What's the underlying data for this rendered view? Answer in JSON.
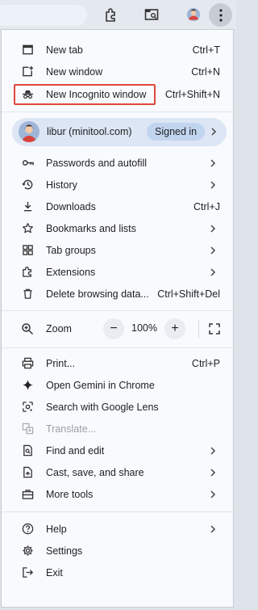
{
  "menu": {
    "group1": [
      {
        "label": "New tab",
        "shortcut": "Ctrl+T",
        "icon": "new-tab-icon"
      },
      {
        "label": "New window",
        "shortcut": "Ctrl+N",
        "icon": "new-window-icon"
      },
      {
        "label": "New Incognito window",
        "shortcut": "Ctrl+Shift+N",
        "icon": "incognito-icon"
      }
    ],
    "profile": {
      "name": "libur (minitool.com)",
      "status": "Signed in"
    },
    "group2": [
      {
        "label": "Passwords and autofill",
        "icon": "key-icon"
      },
      {
        "label": "History",
        "icon": "history-icon"
      },
      {
        "label": "Downloads",
        "shortcut": "Ctrl+J",
        "icon": "download-icon"
      },
      {
        "label": "Bookmarks and lists",
        "icon": "star-icon"
      },
      {
        "label": "Tab groups",
        "icon": "tab-groups-icon"
      },
      {
        "label": "Extensions",
        "icon": "puzzle-icon"
      },
      {
        "label": "Delete browsing data...",
        "shortcut": "Ctrl+Shift+Del",
        "icon": "trash-icon"
      }
    ],
    "zoom": {
      "label": "Zoom",
      "minus": "−",
      "value": "100%",
      "plus": "+"
    },
    "group3": [
      {
        "label": "Print...",
        "shortcut": "Ctrl+P",
        "icon": "print-icon"
      },
      {
        "label": "Open Gemini in Chrome",
        "icon": "gemini-icon"
      },
      {
        "label": "Search with Google Lens",
        "icon": "lens-icon"
      },
      {
        "label": "Translate...",
        "icon": "translate-icon"
      },
      {
        "label": "Find and edit",
        "icon": "find-icon"
      },
      {
        "label": "Cast, save, and share",
        "icon": "cast-icon"
      },
      {
        "label": "More tools",
        "icon": "toolbox-icon"
      }
    ],
    "group4": [
      {
        "label": "Help",
        "icon": "help-icon"
      },
      {
        "label": "Settings",
        "icon": "gear-icon"
      },
      {
        "label": "Exit",
        "icon": "exit-icon"
      }
    ]
  },
  "colors": {
    "highlight": "#e0473d",
    "profile_bg": "#dce6f5",
    "signed_bg": "#c2d5ef",
    "menu_bg": "#f8fafd"
  }
}
